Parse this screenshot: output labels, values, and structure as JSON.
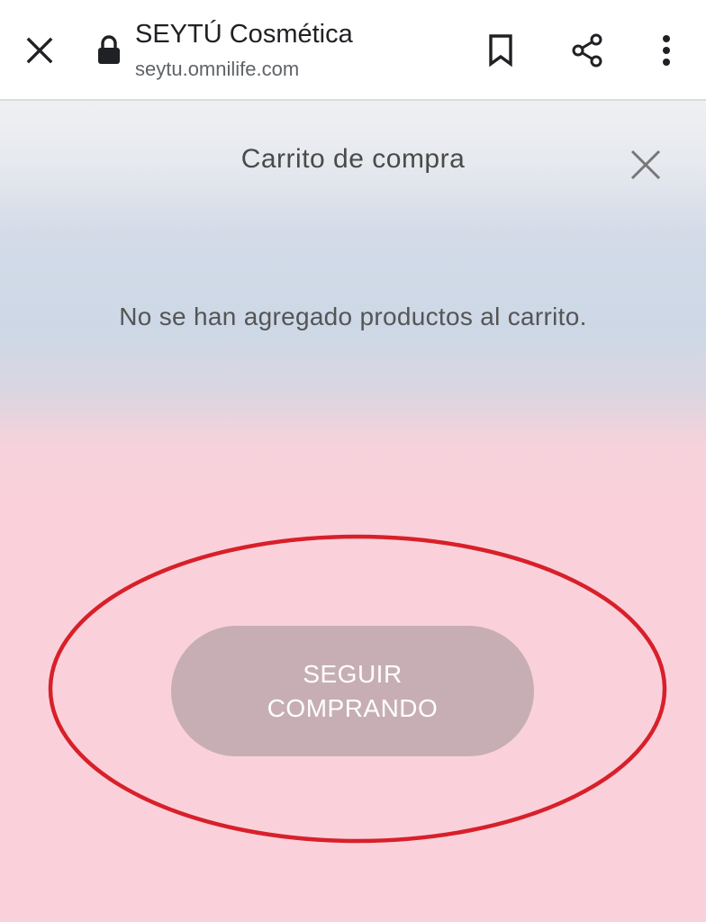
{
  "toolbar": {
    "close_icon": "close-icon",
    "lock_icon": "lock-icon",
    "title": "SEYTÚ Cosmética",
    "url": "seytu.omnilife.com",
    "bookmark_icon": "bookmark-icon",
    "share_icon": "share-icon",
    "more_icon": "more-vert-icon"
  },
  "cart": {
    "title": "Carrito de compra",
    "close_icon": "close-icon",
    "empty_message": "No se han agregado productos al carrito.",
    "continue_button": "SEGUIR COMPRANDO"
  },
  "colors": {
    "button_bg": "#c7aeb5",
    "annotation_circle": "#d8202a",
    "page_pink": "#fad1da",
    "page_blue": "#cdd8e6"
  }
}
